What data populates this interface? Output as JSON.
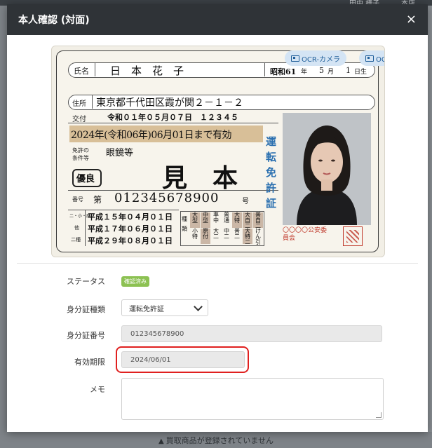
{
  "background": {
    "topbar_text": "田中 様子",
    "topbar_text_right": "本店",
    "footer_notice": "買取商品が登録されていません",
    "footer_icon": "warning-icon"
  },
  "modal": {
    "title": "本人確認 (対面)",
    "close_label": "×"
  },
  "ocr": {
    "camera_label": "OCR-カメラ",
    "scanner_label": "OCR-スキャナ",
    "icon": "id-card-icon"
  },
  "license": {
    "name_label": "氏名",
    "name": "日　本　花　子",
    "birth_era": "昭和61",
    "birth_year_unit": "年",
    "birth_month": "5",
    "birth_month_unit": "月",
    "birth_day": "1",
    "birth_day_unit": "日生",
    "address_label": "住所",
    "address": "東京都千代田区霞が関２－１－２",
    "issue_label": "交付",
    "issue_date": "令和０１年０５月０７日　１２３４５",
    "expiry": "2024年(令和06年)06月01日まで有効",
    "conditions_label": "免許の条件等",
    "conditions": "眼鏡等",
    "sample": "見　本",
    "excellent": "優良",
    "number_label": "番号",
    "number_prefix": "第",
    "number": "012345678900",
    "number_suffix": "号",
    "side_text": "運転免許証",
    "dates_labels": [
      "二・小・原",
      "他",
      "二種"
    ],
    "dates": [
      "平成１５年０４月０１日",
      "平成１７年０６月０１日",
      "平成２９年０８月０１日"
    ],
    "kind_label": "種類",
    "classes_top": [
      "大型",
      "中型",
      "準中",
      "普通",
      "大特",
      "大自二",
      "普自二"
    ],
    "classes_bottom": [
      "小特",
      "原付",
      "大二",
      "中二",
      "普二",
      "大特二",
      "けん引"
    ],
    "issuer": "〇〇〇〇公安委員会"
  },
  "form": {
    "status_label": "ステータス",
    "status_value": "確認済み",
    "id_type_label": "身分証種類",
    "id_type_value": "運転免許証",
    "id_number_label": "身分証番号",
    "id_number_value": "012345678900",
    "expiry_label": "有効期限",
    "expiry_value": "2024/06/01",
    "memo_label": "メモ",
    "memo_value": ""
  },
  "colors": {
    "header_bg": "#2f3337",
    "status_badge": "#8cc152",
    "highlight_border": "#e0201f",
    "ocr_button": "#d4e4f4",
    "expiry_band": "#d8bf98",
    "side_text": "#2a6fb0"
  }
}
